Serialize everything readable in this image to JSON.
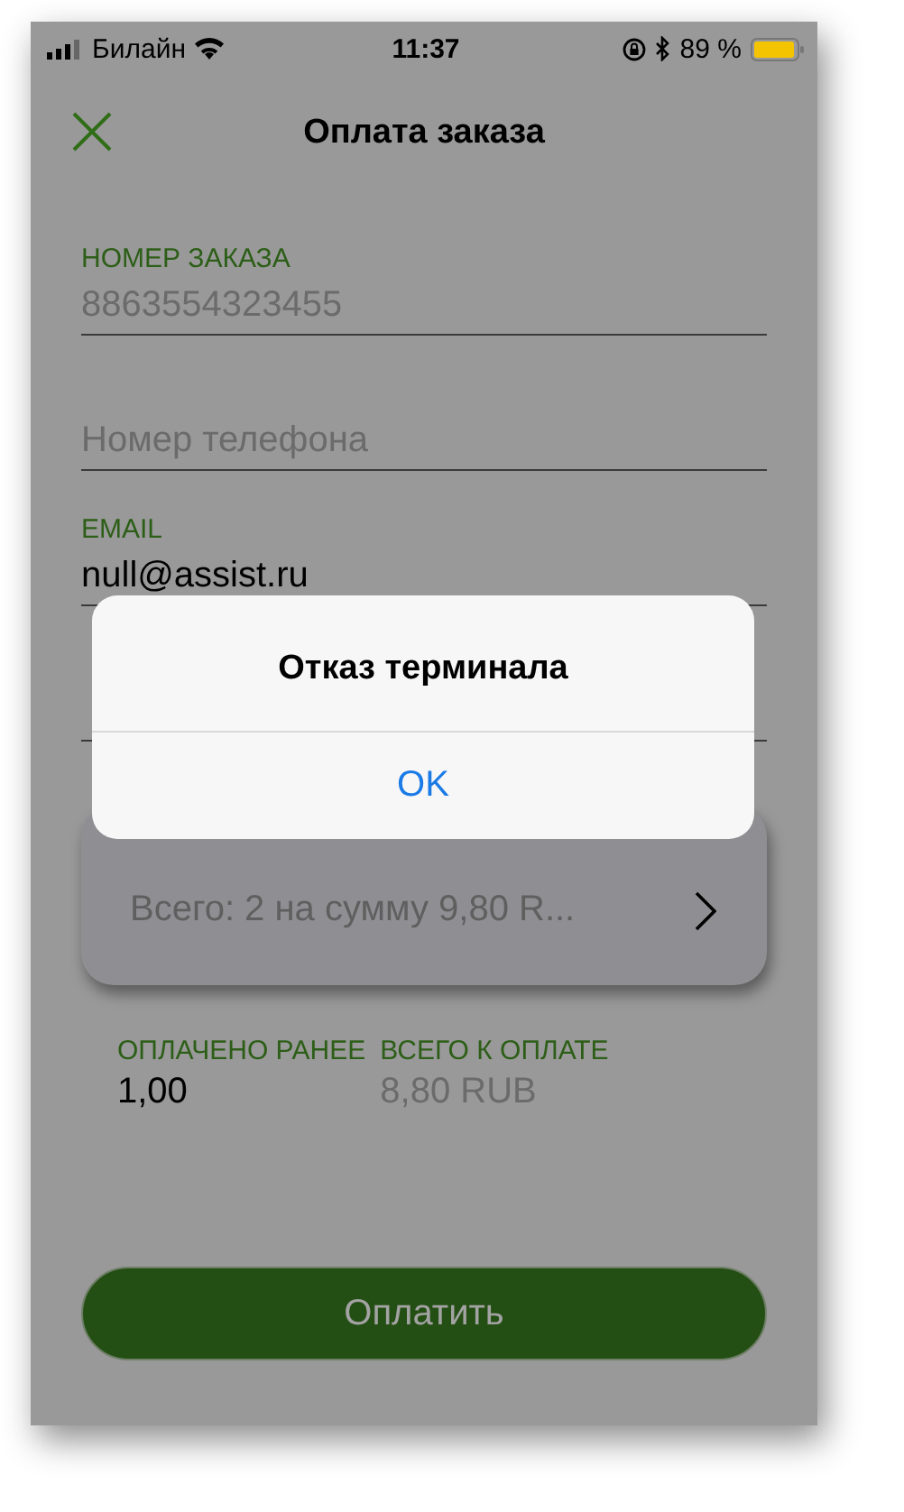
{
  "status_bar": {
    "carrier": "Билайн",
    "time": "11:37",
    "battery": "89 %"
  },
  "nav": {
    "title": "Оплата заказа"
  },
  "fields": [
    {
      "kind": "labeled",
      "label": "НОМЕР ЗАКАЗА",
      "value": "8863554323455",
      "disabled": true
    },
    {
      "kind": "placeholder",
      "placeholder": "Номер телефона"
    },
    {
      "kind": "labeled",
      "label": "EMAIL",
      "value": "null@assist.ru",
      "disabled": false
    },
    {
      "kind": "covered"
    }
  ],
  "order_items": {
    "summary": "Всего: 2 на сумму 9,80 R..."
  },
  "totals": [
    {
      "label": "ОПЛАЧЕНО РАНЕЕ",
      "value": "1,00",
      "disabled": false
    },
    {
      "label": "ВСЕГО К ОПЛАТЕ",
      "value": "8,80 RUB",
      "disabled": true
    }
  ],
  "pay_button": {
    "label": "Оплатить",
    "disabled": true
  },
  "alert": {
    "title": "Отказ терминала",
    "buttons": [
      "OK"
    ]
  }
}
